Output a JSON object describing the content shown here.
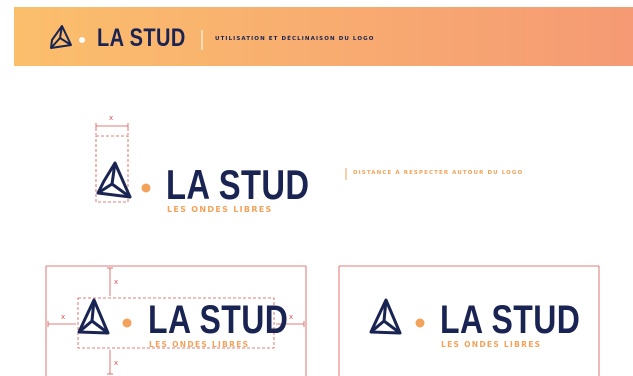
{
  "brand": {
    "name": "LA STUD",
    "tagline": "LES ONDES LIBRES",
    "colors": {
      "navy": "#1a2452",
      "orange": "#f2a25a",
      "guide_red": "#d9534f",
      "banner_start": "#fbbf6c",
      "banner_end": "#f59a74"
    }
  },
  "header": {
    "title": "UTILISATION ET DÉCLINAISON DU LOGO"
  },
  "spacing_demo": {
    "caption": "DISTANCE À RESPECTER AUTOUR DU LOGO",
    "x_label": "x"
  }
}
